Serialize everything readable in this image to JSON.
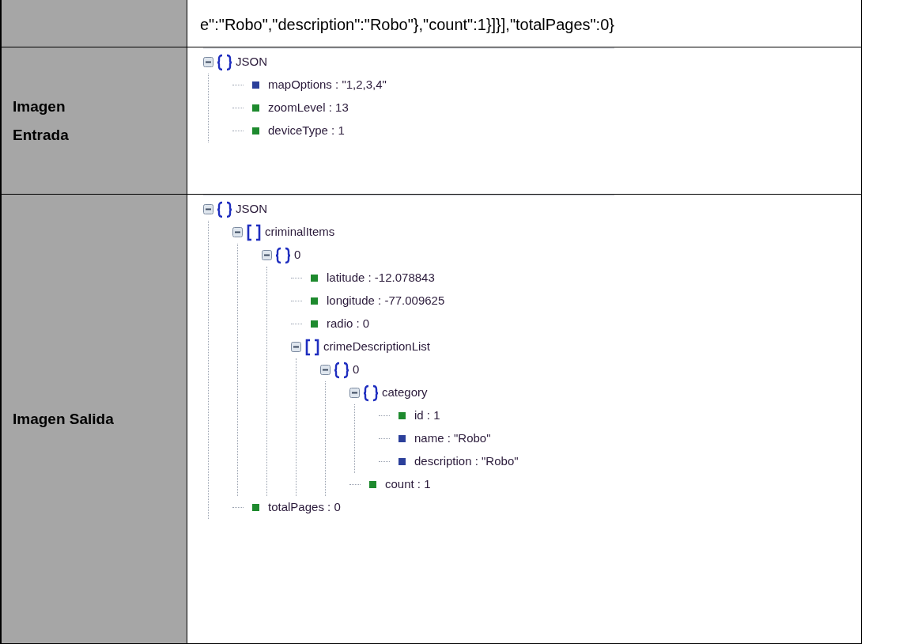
{
  "rows": [
    {
      "label_lines": [],
      "content": {
        "kind": "text",
        "text": "e\":\"Robo\",\"description\":\"Robo\"},\"count\":1}]}],\"totalPages\":0}"
      }
    },
    {
      "label_lines": [
        "Imagen",
        "Entrada"
      ],
      "content": {
        "kind": "tree",
        "root": {
          "kind": "object",
          "label": "JSON",
          "expanded": true,
          "children": [
            {
              "kind": "string",
              "label": "mapOptions : \"1,2,3,4\""
            },
            {
              "kind": "number",
              "label": "zoomLevel : 13"
            },
            {
              "kind": "number",
              "label": "deviceType : 1"
            }
          ]
        }
      }
    },
    {
      "label_lines": [
        "Imagen Salida"
      ],
      "content": {
        "kind": "tree",
        "root": {
          "kind": "object",
          "label": "JSON",
          "expanded": true,
          "children": [
            {
              "kind": "array",
              "label": "criminalItems",
              "expanded": true,
              "children": [
                {
                  "kind": "object",
                  "label": "0",
                  "expanded": true,
                  "children": [
                    {
                      "kind": "number",
                      "label": "latitude : -12.078843"
                    },
                    {
                      "kind": "number",
                      "label": "longitude : -77.009625"
                    },
                    {
                      "kind": "number",
                      "label": "radio : 0"
                    },
                    {
                      "kind": "array",
                      "label": "crimeDescriptionList",
                      "expanded": true,
                      "children": [
                        {
                          "kind": "object",
                          "label": "0",
                          "expanded": true,
                          "children": [
                            {
                              "kind": "object",
                              "label": "category",
                              "expanded": true,
                              "children": [
                                {
                                  "kind": "number",
                                  "label": "id : 1"
                                },
                                {
                                  "kind": "string",
                                  "label": "name : \"Robo\""
                                },
                                {
                                  "kind": "string",
                                  "label": "description : \"Robo\""
                                }
                              ]
                            },
                            {
                              "kind": "number",
                              "label": "count : 1"
                            }
                          ]
                        }
                      ]
                    }
                  ]
                }
              ]
            },
            {
              "kind": "number",
              "label": "totalPages : 0"
            }
          ]
        }
      }
    }
  ]
}
